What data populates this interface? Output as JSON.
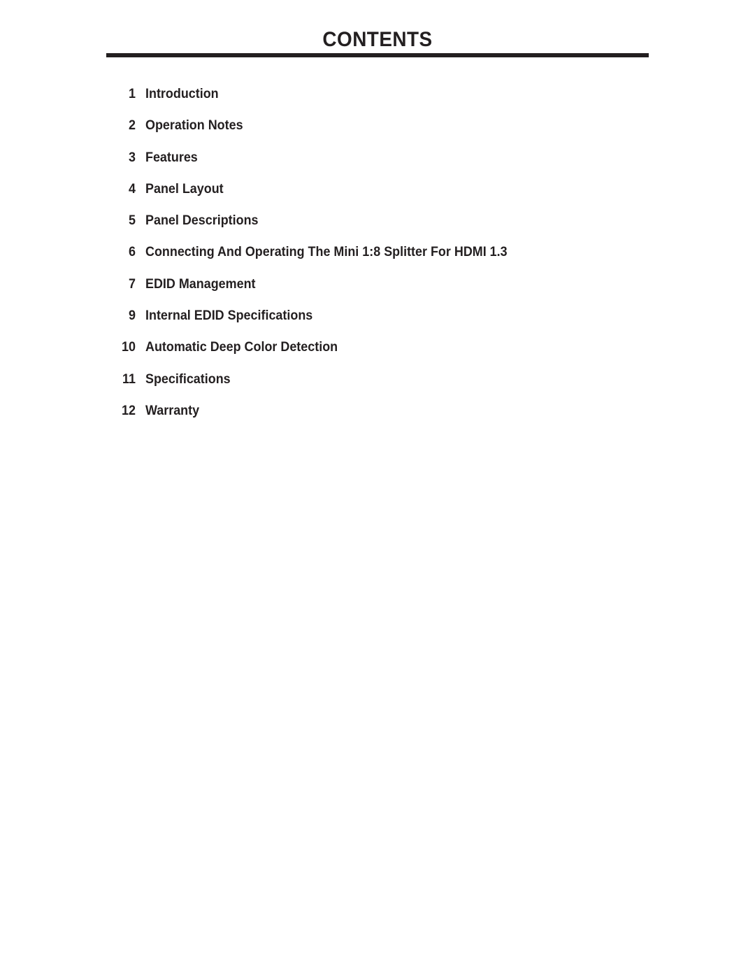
{
  "document": {
    "title": "CONTENTS",
    "text_color": "#231f20",
    "background_color": "#ffffff",
    "rule_color": "#231f20"
  },
  "toc": {
    "entries": [
      {
        "number": "1",
        "label": "Introduction"
      },
      {
        "number": "2",
        "label": "Operation Notes"
      },
      {
        "number": "3",
        "label": "Features"
      },
      {
        "number": "4",
        "label": "Panel Layout"
      },
      {
        "number": "5",
        "label": "Panel Descriptions"
      },
      {
        "number": "6",
        "label": "Connecting And Operating The Mini 1:8 Splitter For HDMI 1.3"
      },
      {
        "number": "7",
        "label": "EDID Management"
      },
      {
        "number": "9",
        "label": "Internal EDID Specifications"
      },
      {
        "number": "10",
        "label": "Automatic Deep Color Detection"
      },
      {
        "number": "11",
        "label": "Specifications"
      },
      {
        "number": "12",
        "label": "Warranty"
      }
    ]
  }
}
